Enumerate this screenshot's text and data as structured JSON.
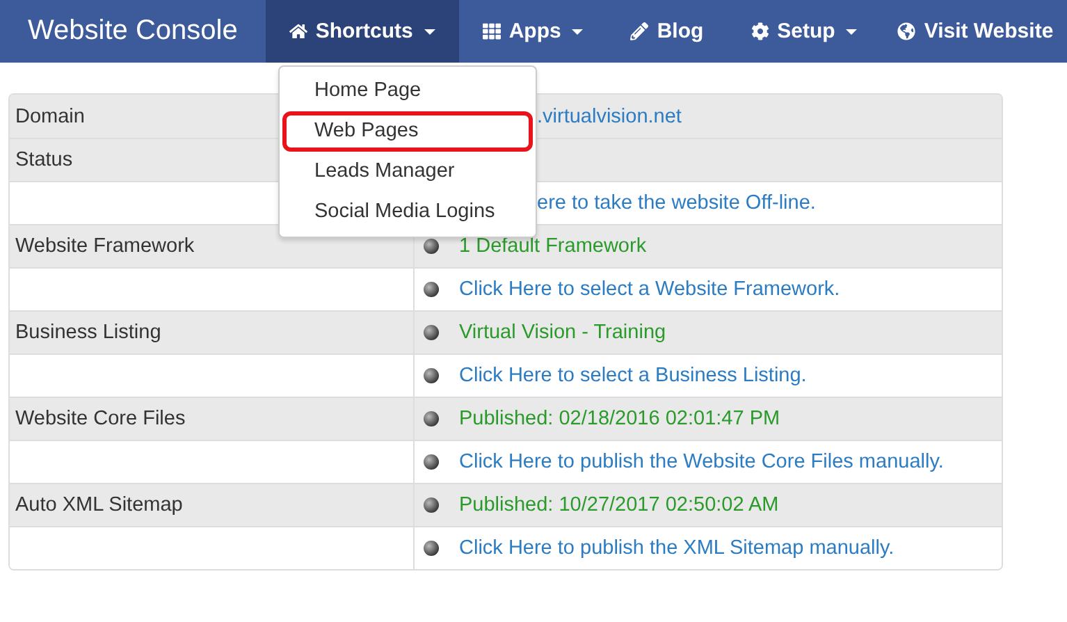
{
  "navbar": {
    "brand": "Website Console",
    "items": [
      {
        "label": "Shortcuts",
        "dropdown": true,
        "selected": true
      },
      {
        "label": "Apps",
        "dropdown": true,
        "selected": false
      },
      {
        "label": "Blog",
        "dropdown": false,
        "selected": false
      },
      {
        "label": "Setup",
        "dropdown": true,
        "selected": false
      },
      {
        "label": "Visit Website",
        "dropdown": false,
        "selected": false
      }
    ]
  },
  "dropdown_menu": {
    "items": [
      {
        "label": "Home Page",
        "highlighted": false
      },
      {
        "label": "Web Pages",
        "highlighted": true
      },
      {
        "label": "Leads Manager",
        "highlighted": false
      },
      {
        "label": "Social Media Logins",
        "highlighted": false
      }
    ]
  },
  "table": {
    "rows": [
      {
        "label": "Domain",
        "value": ".virtualvision.net",
        "kind": "link",
        "bullet": false
      },
      {
        "label": "Status",
        "kind": "empty"
      },
      {
        "value": "ere to take the website Off-line.",
        "kind": "link",
        "bullet": false
      },
      {
        "label": "Website Framework",
        "value": "1 Default Framework",
        "kind": "status",
        "bullet": true
      },
      {
        "value": "Click Here to select a Website Framework.",
        "kind": "link",
        "bullet": true
      },
      {
        "label": "Business Listing",
        "value": "Virtual Vision - Training",
        "kind": "status",
        "bullet": true
      },
      {
        "value": "Click Here to select a Business Listing.",
        "kind": "link",
        "bullet": true
      },
      {
        "label": "Website Core Files",
        "value": "Published: 02/18/2016 02:01:47 PM",
        "kind": "status",
        "bullet": true
      },
      {
        "value": "Click Here to publish the Website Core Files manually.",
        "kind": "link",
        "bullet": true
      },
      {
        "label": "Auto XML Sitemap",
        "value": "Published: 10/27/2017 02:50:02 AM",
        "kind": "status",
        "bullet": true
      },
      {
        "value": "Click Here to publish the XML Sitemap manually.",
        "kind": "link",
        "bullet": true
      }
    ]
  }
}
